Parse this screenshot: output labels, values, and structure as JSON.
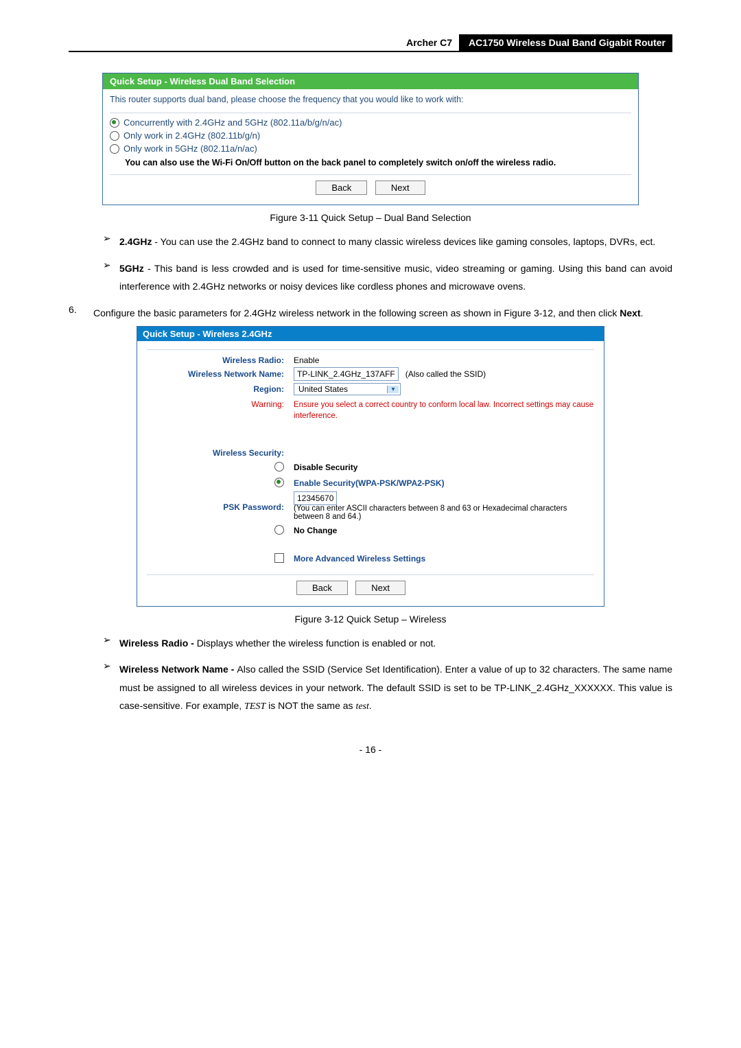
{
  "header": {
    "model": "Archer C7",
    "title": "AC1750 Wireless Dual Band Gigabit Router"
  },
  "panel1": {
    "title": "Quick Setup - Wireless Dual Band Selection",
    "supports": "This router supports dual band, please choose the frequency that you would like to work with:",
    "opt1": "Concurrently with 2.4GHz and 5GHz (802.11a/b/g/n/ac)",
    "opt2": "Only work in 2.4GHz (802.11b/g/n)",
    "opt3": "Only work in 5GHz (802.11a/n/ac)",
    "note": "You can also use the Wi-Fi On/Off button on the back panel to completely switch on/off the wireless radio.",
    "back": "Back",
    "next": "Next"
  },
  "caption1": "Figure 3-11 Quick Setup – Dual Band Selection",
  "bullet1": {
    "label": "2.4GHz",
    "text": " - You can use the 2.4GHz band to connect to many classic wireless devices like gaming consoles, laptops, DVRs, ect."
  },
  "bullet2": {
    "label": "5GHz",
    "text": " - This band is less crowded and is used for time-sensitive music, video streaming or gaming. Using this band can avoid interference with 2.4GHz networks or noisy devices like cordless phones and microwave ovens."
  },
  "step6": {
    "num": "6.",
    "text_a": "Configure the basic parameters for 2.4GHz wireless network in the following screen as shown in Figure 3-12, and then click ",
    "text_b": "Next",
    "text_c": "."
  },
  "panel2": {
    "title": "Quick Setup - Wireless 2.4GHz",
    "wireless_radio_label": "Wireless Radio:",
    "wireless_radio_value": "Enable",
    "network_name_label": "Wireless Network Name:",
    "network_name_value": "TP-LINK_2.4GHz_137AFF",
    "ssid_hint": "(Also called the SSID)",
    "region_label": "Region:",
    "region_value": "United States",
    "warning_label": "Warning:",
    "warning_text": "Ensure you select a correct country to conform local law. Incorrect settings may cause interference.",
    "security_label": "Wireless Security:",
    "disable_security": "Disable Security",
    "enable_security": "Enable Security(WPA-PSK/WPA2-PSK)",
    "psk_label": "PSK Password:",
    "psk_value": "12345670",
    "psk_note": "(You can enter ASCII characters between 8 and 63 or Hexadecimal characters between 8 and 64.)",
    "no_change": "No Change",
    "more_advanced": "More Advanced Wireless Settings",
    "back": "Back",
    "next": "Next"
  },
  "caption2": "Figure 3-12 Quick Setup – Wireless",
  "bullet3": {
    "label": "Wireless Radio - ",
    "text": "Displays whether the wireless function is enabled or not."
  },
  "bullet4": {
    "label": "Wireless Network Name - ",
    "text_a": "Also called the SSID (Service Set Identification). Enter a value of up to 32 characters. The same name must be assigned to all wireless devices in your network. The default SSID is set to be TP-LINK_2.4GHz_XXXXXX. This value is case-sensitive. For example, ",
    "test": "TEST",
    "text_b": " is NOT the same as ",
    "test2": "test",
    "text_c": "."
  },
  "footer": "- 16 -"
}
